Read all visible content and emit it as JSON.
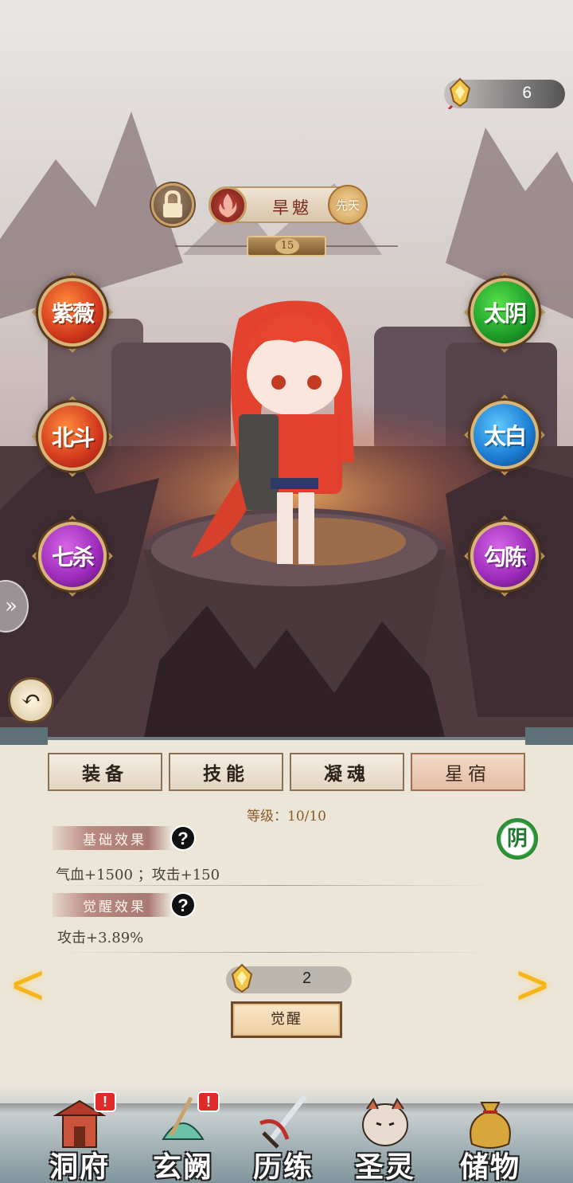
{
  "currency": {
    "top_amount": "6",
    "cost_amount": "2"
  },
  "character": {
    "name": "旱魃",
    "badge": "先天",
    "level": "15"
  },
  "star_buttons": {
    "left": [
      {
        "label": "紫薇",
        "color": "red"
      },
      {
        "label": "北斗",
        "color": "red"
      },
      {
        "label": "七杀",
        "color": "purple"
      }
    ],
    "right": [
      {
        "label": "太阴",
        "color": "green"
      },
      {
        "label": "太白",
        "color": "blue"
      },
      {
        "label": "勾陈",
        "color": "purple"
      }
    ]
  },
  "tabs": [
    {
      "label": "装备",
      "active": false
    },
    {
      "label": "技能",
      "active": false
    },
    {
      "label": "凝魂",
      "active": false
    },
    {
      "label": "星宿",
      "active": true
    }
  ],
  "panel": {
    "level_text": "等级：10/10",
    "base_title": "基础效果",
    "base_stats": "气血+1500  ；攻击+150",
    "awaken_title": "觉醒效果",
    "awaken_stats": "攻击+3.89%",
    "yin_badge": "阴",
    "awaken_button": "觉醒",
    "help_symbol": "?"
  },
  "bottom_nav": [
    {
      "label": "洞府",
      "alert": "!"
    },
    {
      "label": "玄阙",
      "alert": "!"
    },
    {
      "label": "历练",
      "alert": ""
    },
    {
      "label": "圣灵",
      "alert": ""
    },
    {
      "label": "储物",
      "alert": ""
    }
  ],
  "colors": {
    "accent_gold": "#f5b41c",
    "panel_bg": "#ece6d9",
    "tab_active": "#e4bea5"
  }
}
